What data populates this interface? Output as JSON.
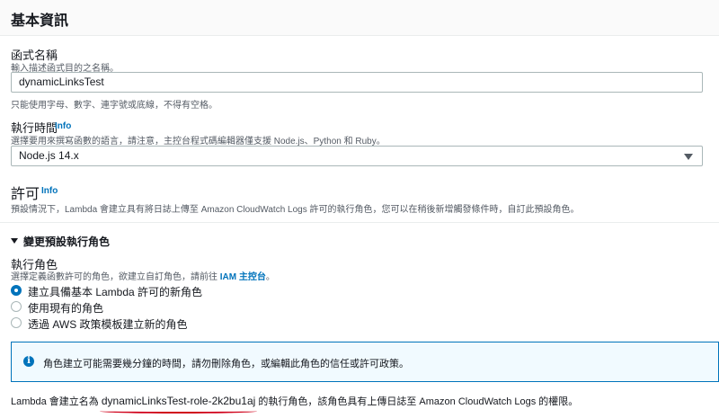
{
  "header": {
    "title": "基本資訊"
  },
  "function_name": {
    "label": "函式名稱",
    "description": "輸入描述函式目的之名稱。",
    "value": "dynamicLinksTest",
    "hint": "只能使用字母、數字、連字號或底線，不得有空格。"
  },
  "runtime": {
    "label": "執行時間",
    "info": "Info",
    "description": "選擇要用來撰寫函數的語言，請注意，主控台程式碼編輯器僅支援 Node.js、Python 和 Ruby。",
    "value": "Node.js 14.x"
  },
  "permissions": {
    "title": "許可",
    "info": "Info",
    "description": "預設情況下，Lambda 會建立具有將日誌上傳至 Amazon CloudWatch Logs 許可的執行角色，您可以在稍後新增觸發條件時，自訂此預設角色。"
  },
  "change_role": {
    "toggle_label": "變更預設執行角色",
    "label": "執行角色",
    "description_prefix": "選擇定義函數許可的角色，欲建立自訂角色，請前往",
    "iam_link": "IAM 主控台",
    "description_suffix": "。",
    "options": [
      {
        "label": "建立具備基本 Lambda 許可的新角色",
        "checked": true
      },
      {
        "label": "使用現有的角色",
        "checked": false
      },
      {
        "label": "透過 AWS 政策模板建立新的角色",
        "checked": false
      }
    ]
  },
  "alert": {
    "icon": "info-icon",
    "glyph": "i",
    "text": "角色建立可能需要幾分鐘的時間，請勿刪除角色，或編輯此角色的信任或許可政策。"
  },
  "footer": {
    "prefix": "Lambda 會建立名為",
    "role_name": "dynamicLinksTest-role-2k2bu1aj",
    "suffix": "的執行角色，該角色具有上傳日誌至 Amazon CloudWatch Logs 的權限。"
  },
  "colors": {
    "accent": "#0073bb",
    "annotation": "#d0021b"
  }
}
